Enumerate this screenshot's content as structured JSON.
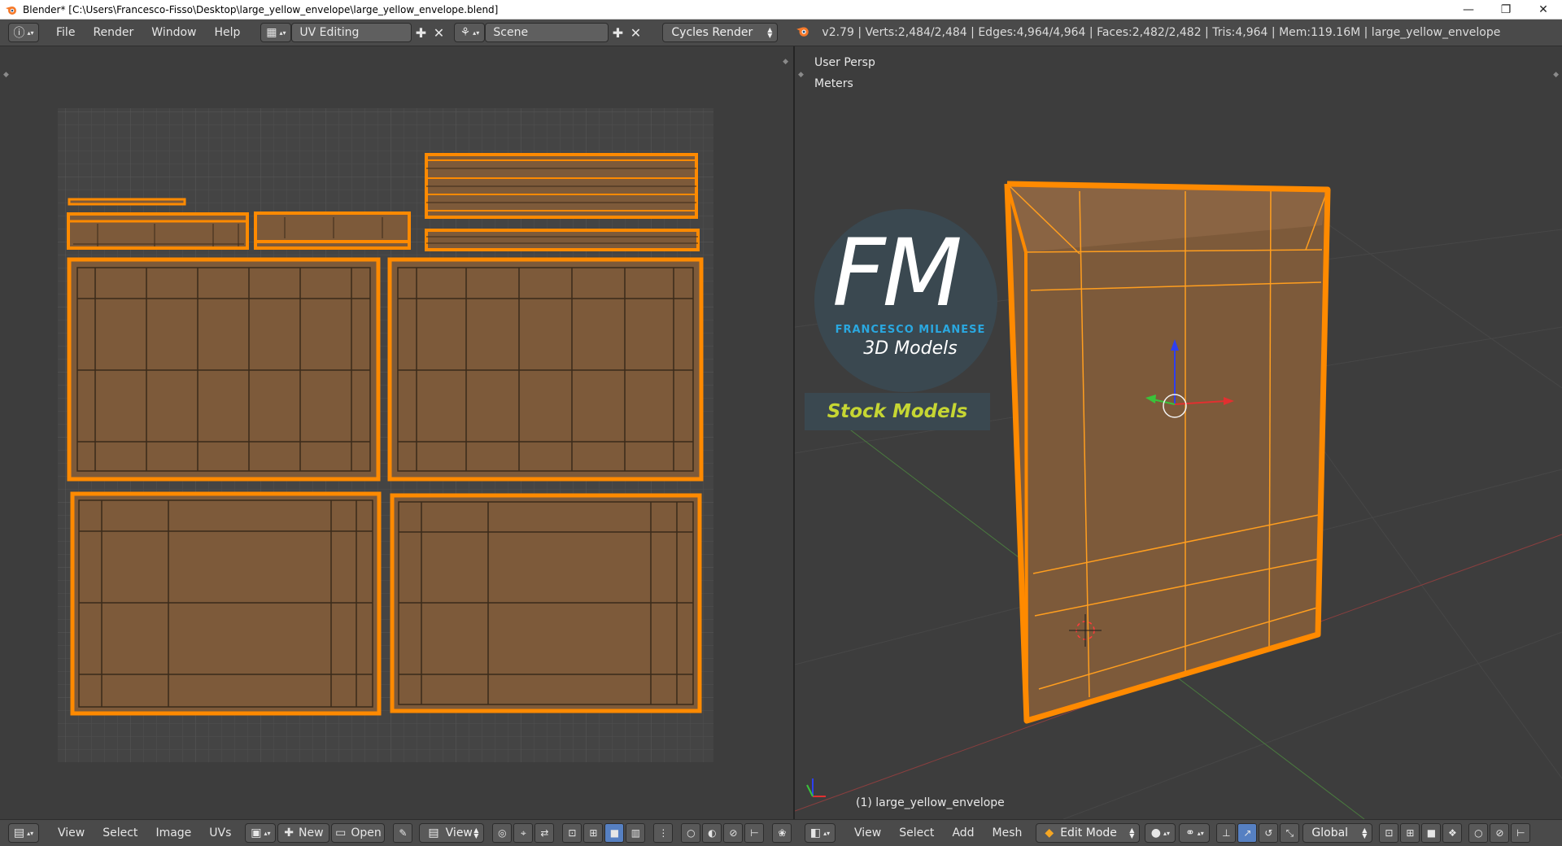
{
  "window": {
    "title": "Blender* [C:\\Users\\Francesco-Fisso\\Desktop\\large_yellow_envelope\\large_yellow_envelope.blend]",
    "minimize": "—",
    "restore": "❐",
    "close": "✕"
  },
  "infobar": {
    "menus": [
      "File",
      "Render",
      "Window",
      "Help"
    ],
    "screen_layout": "UV Editing",
    "scene": "Scene",
    "render_engine": "Cycles Render",
    "stats": "v2.79 | Verts:2,484/2,484 | Edges:4,964/4,964 | Faces:2,482/2,482 | Tris:4,964 | Mem:119.16M | large_yellow_envelope"
  },
  "viewport": {
    "view_name": "User Persp",
    "units": "Meters",
    "object_label": "(1) large_yellow_envelope"
  },
  "watermark": {
    "logo_letters": "FM",
    "brand": "FRANCESCO MILANESE",
    "subtitle": "3D Models",
    "banner": "Stock Models"
  },
  "uv_header": {
    "menus": [
      "View",
      "Select",
      "Image",
      "UVs"
    ],
    "new_label": "New",
    "open_label": "Open",
    "view_label": "View"
  },
  "v3d_header": {
    "menus": [
      "View",
      "Select",
      "Add",
      "Mesh"
    ],
    "mode": "Edit Mode",
    "orientation": "Global"
  },
  "colors": {
    "accent_orange": "#ff8a00",
    "face_fill": "#7d5a3a",
    "selected_blue": "#5680c2",
    "background": "#3d3d3d"
  }
}
